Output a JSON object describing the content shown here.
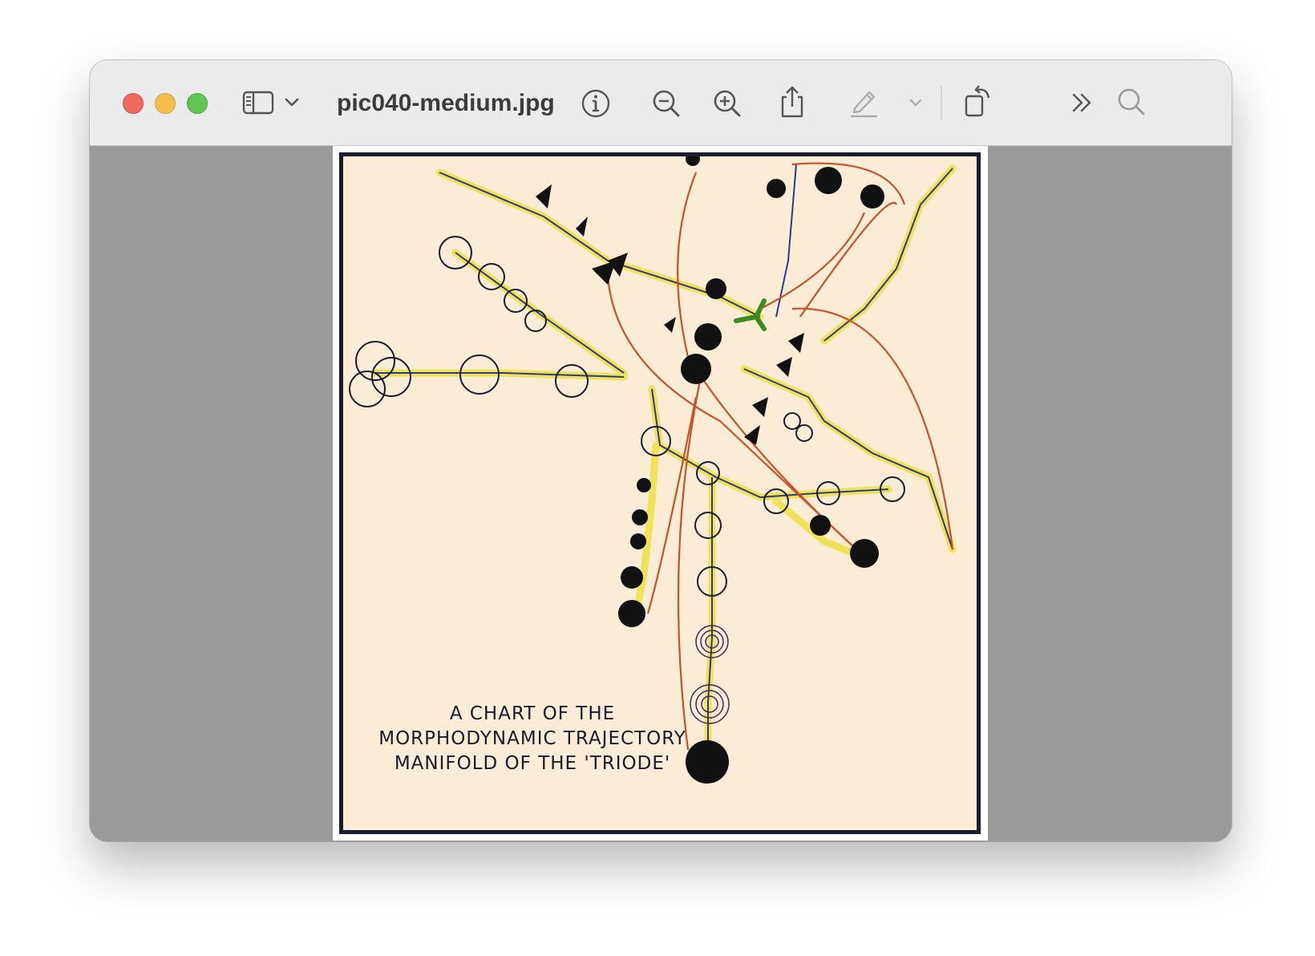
{
  "window": {
    "title": "pic040-medium.jpg"
  },
  "toolbar": {
    "icons": [
      "sidebar-icon",
      "chevron-down-icon",
      "info-icon",
      "zoom-out-icon",
      "zoom-in-icon",
      "share-icon",
      "markup-pen-icon",
      "chevron-down-icon",
      "rotate-icon",
      "more-chevrons-icon",
      "search-icon"
    ]
  },
  "image": {
    "caption_line1": "A CHART OF THE",
    "caption_line2": "MORPHODYNAMIC TRAJECTORY",
    "caption_line3": "MANIFOLD OF THE 'TRIODE'"
  },
  "colors": {
    "close": "#ed6a5e",
    "minimize": "#f5bf4f",
    "zoom": "#61c554",
    "canvas_bg": "#9a9a9a",
    "paper": "#fbecd6",
    "highlight": "#f0e04a",
    "arrow_red": "#c8512a",
    "ink": "#1b1b2e"
  }
}
